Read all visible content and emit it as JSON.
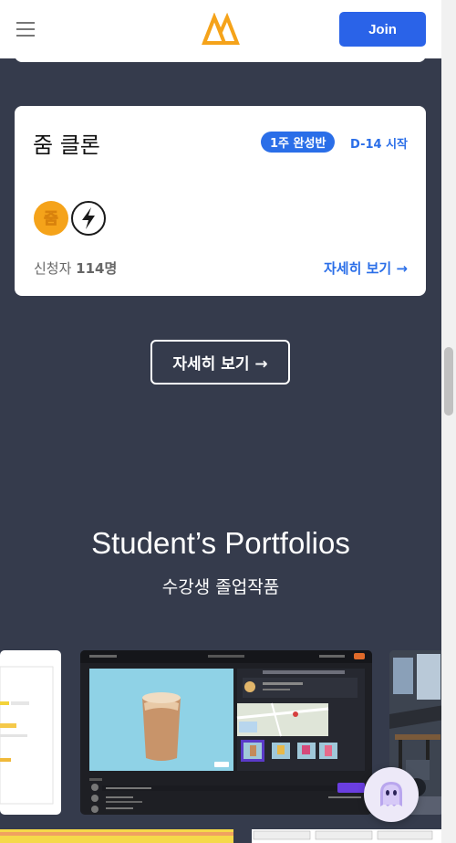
{
  "header": {
    "join_label": "Join"
  },
  "course_card": {
    "title": "줌 클론",
    "badge": "1주 완성반",
    "dday": "D-14 시작",
    "applicants_prefix": "신청자 ",
    "applicants_count": "114명",
    "detail_link": "자세히 보기 →",
    "badge_icons": [
      "zoom-badge-icon",
      "lightning-icon"
    ]
  },
  "more_button": "자세히 보기 →",
  "portfolio": {
    "title": "Student’s Portfolios",
    "subtitle": "수강생 졸업작품"
  },
  "colors": {
    "background": "#353b4c",
    "accent": "#2a63e8",
    "logo": "#f5a31a"
  }
}
